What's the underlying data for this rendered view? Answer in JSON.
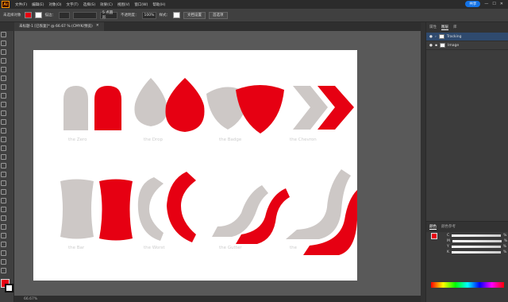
{
  "menubar": {
    "app_logo": "Ai",
    "items": [
      "文件(F)",
      "编辑(E)",
      "对象(O)",
      "文字(T)",
      "选择(S)",
      "效果(C)",
      "视图(V)",
      "窗口(W)",
      "帮助(H)"
    ],
    "share_label": "共享"
  },
  "controlbar": {
    "selection_label": "未选择对象",
    "stroke_label": "描边：",
    "opacity_label": "不透明度：",
    "opacity_value": "100%",
    "style_label": "样式：",
    "doc_setup_label": "文档设置",
    "prefs_label": "首选项",
    "point_label": "5 点圆形"
  },
  "document": {
    "tab_title": "未标题-1 [已恢复]* @ 66.67 % (CMYK/预览)",
    "zoom": "66.67%",
    "labels": [
      "the Zero",
      "the Drop",
      "the Badge",
      "the Chevron",
      "the Bar",
      "the Worst",
      "the Gutter",
      "the"
    ]
  },
  "panels": {
    "tabs": [
      "属性",
      "图层",
      "库"
    ],
    "layers": [
      {
        "name": "Tracking"
      },
      {
        "name": "Image"
      }
    ],
    "color_tabs": [
      "颜色",
      "颜色参考"
    ],
    "channels": [
      "C",
      "M",
      "Y",
      "K"
    ],
    "percent": "%"
  },
  "colors": {
    "accent_red": "#e60012",
    "shape_gray": "#cdc8c6"
  }
}
